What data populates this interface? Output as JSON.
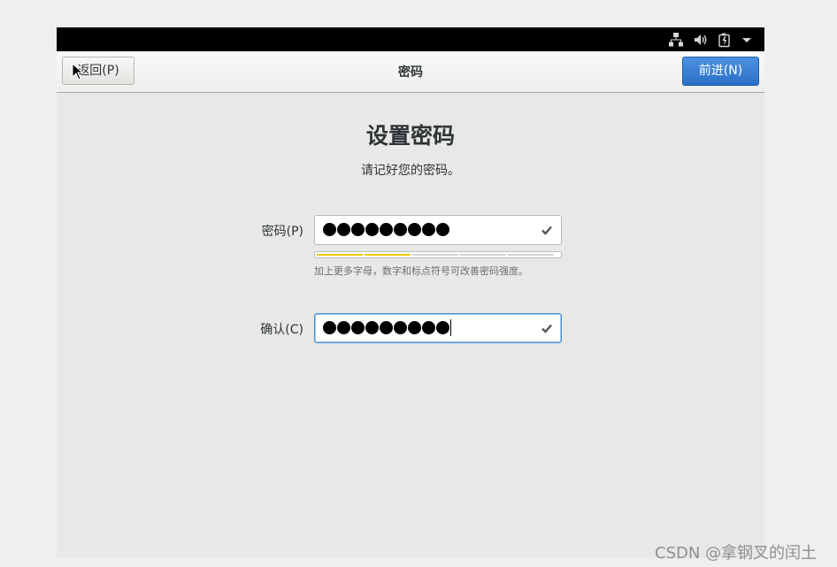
{
  "header": {
    "back_label": "返回(P)",
    "title": "密码",
    "next_label": "前进(N)"
  },
  "tray": {
    "icons": [
      "network-icon",
      "volume-icon",
      "battery-icon",
      "chevron-down-icon"
    ]
  },
  "page": {
    "heading": "设置密码",
    "subtitle": "请记好您的密码。"
  },
  "password": {
    "label": "密码(P)",
    "masked_length": 9,
    "valid": true
  },
  "strength": {
    "segments": 5,
    "filled": 2,
    "color": "#edc900",
    "hint": "加上更多字母，数字和标点符号可改善密码强度。"
  },
  "confirm": {
    "label": "确认(C)",
    "masked_length": 9,
    "valid": true,
    "focused": true
  },
  "watermark": "CSDN @拿钢叉的闰土",
  "colors": {
    "accent": "#3a80d4",
    "strength_fill": "#edc900"
  }
}
